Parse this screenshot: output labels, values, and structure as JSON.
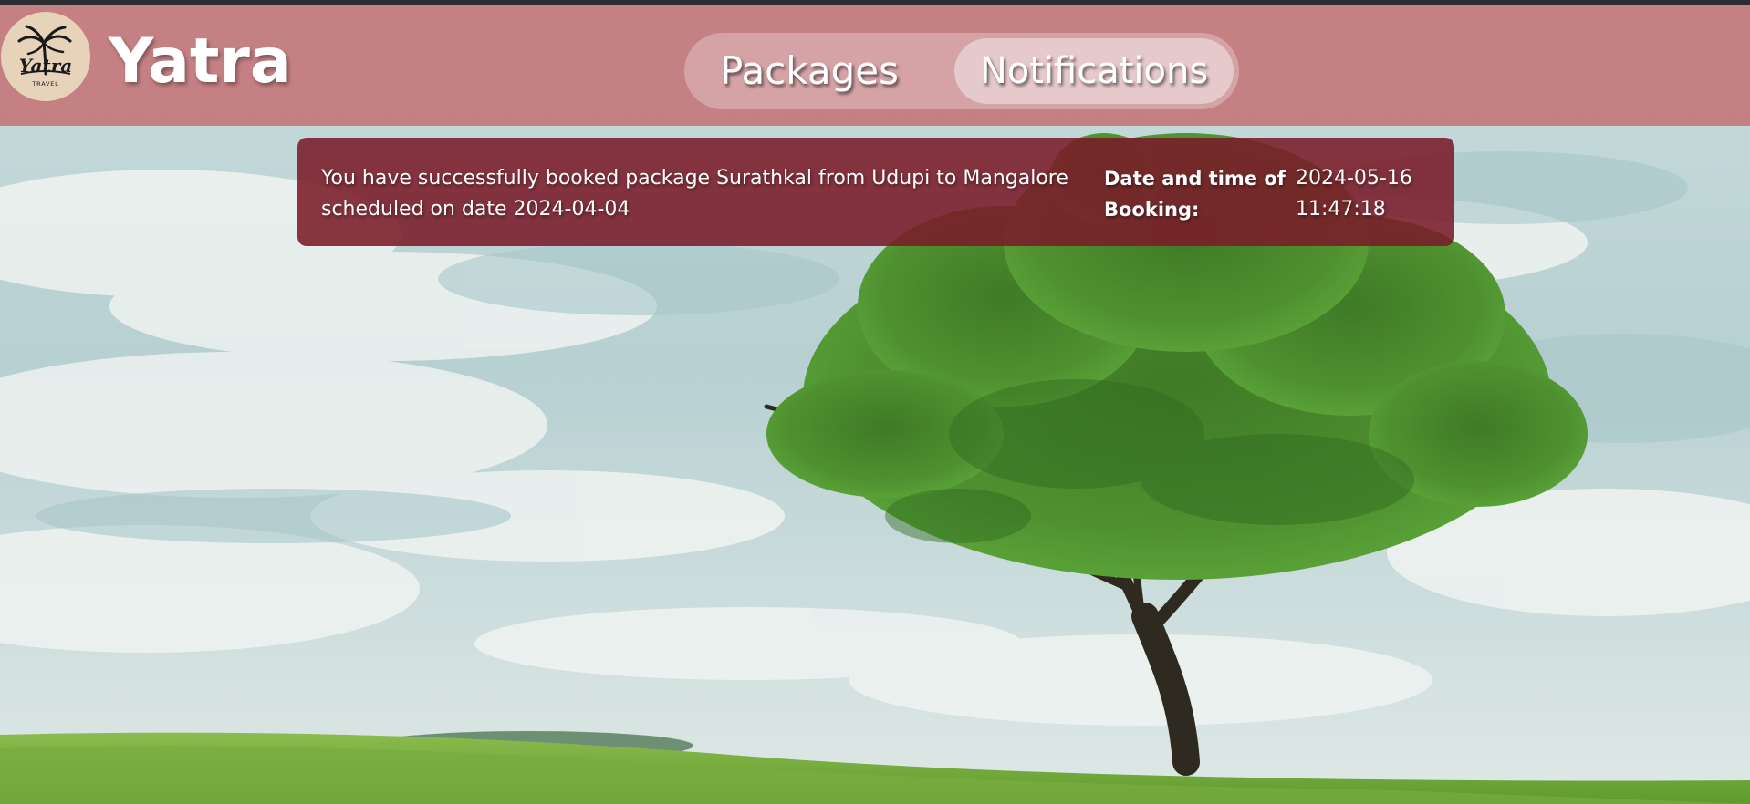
{
  "header": {
    "brand": "Yatra",
    "logo": {
      "script_text": "Yatra",
      "sub_text": "TRAVEL",
      "icon": "palm-tree-icon"
    }
  },
  "nav": {
    "items": [
      {
        "label": "Packages",
        "active": false
      },
      {
        "label": "Notifications",
        "active": true
      }
    ]
  },
  "notifications": [
    {
      "message": "You have successfully booked package Surathkal from Udupi to Mangalore scheduled on date 2024-04-04",
      "label": "Date and time of Booking:",
      "date": "2024-05-16",
      "time": "11:47:18"
    }
  ],
  "colors": {
    "header": "#c47073",
    "notification": "#7a1b29",
    "top_bar": "#2a2c30"
  }
}
